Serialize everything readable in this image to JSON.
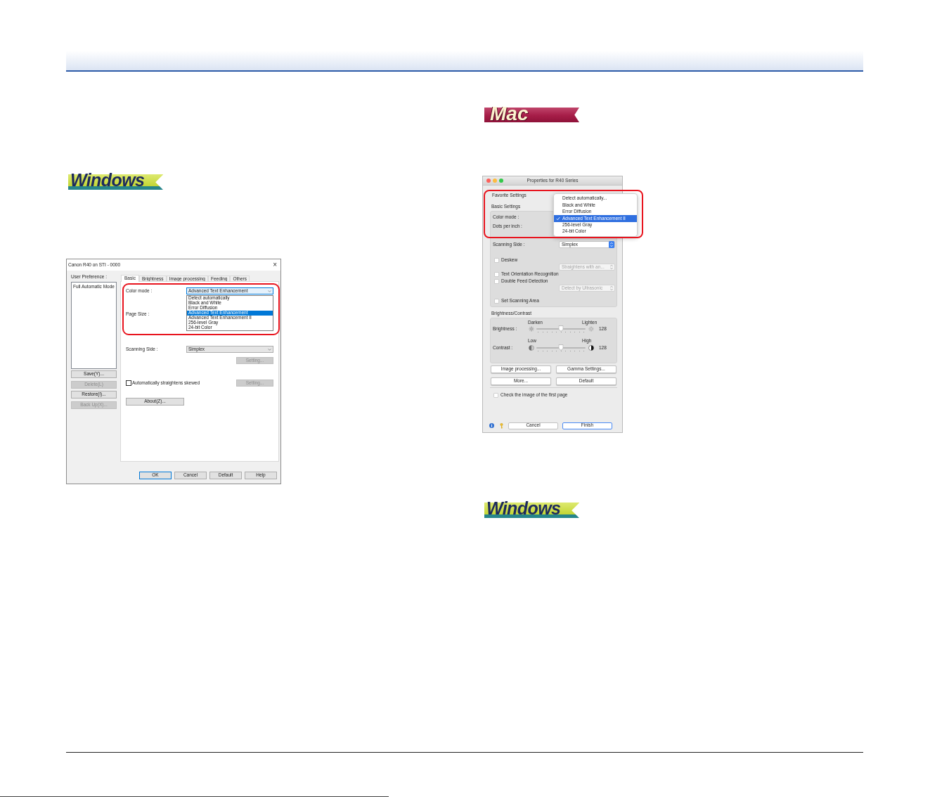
{
  "windows_section": {
    "platform_badge": {
      "kind": "windows",
      "label": "Windows"
    },
    "dialog": {
      "title": "Canon R40 on STI - 0000",
      "close": "×",
      "preference_label": "User Preference :",
      "preference_list": [
        "Full Automatic Mode"
      ],
      "preference_buttons": [
        {
          "label": "Save(Y)...",
          "disabled": false
        },
        {
          "label": "Delete(L)",
          "disabled": true
        },
        {
          "label": "Restore(I)...",
          "disabled": false
        },
        {
          "label": "Back Up(X)...",
          "disabled": true
        }
      ],
      "tabs": [
        {
          "label": "Basic",
          "selected": true
        },
        {
          "label": "Brightness",
          "selected": false
        },
        {
          "label": "Image processing",
          "selected": false
        },
        {
          "label": "Feeding",
          "selected": false
        },
        {
          "label": "Others",
          "selected": false
        }
      ],
      "color_mode": {
        "label": "Color mode :",
        "value": "Advanced Text Enhancement",
        "options": [
          {
            "label": "Detect automatically",
            "selected": false
          },
          {
            "label": "Black and White",
            "selected": false
          },
          {
            "label": "Error Diffusion",
            "selected": false
          },
          {
            "label": "Advanced Text Enhancement",
            "selected": true
          },
          {
            "label": "Advanced Text Enhancement II",
            "selected": false
          },
          {
            "label": "256-level Gray",
            "selected": false
          },
          {
            "label": "24-bit Color",
            "selected": false
          }
        ]
      },
      "page_size": {
        "label": "Page Size :"
      },
      "scanning_side": {
        "label": "Scanning Side :",
        "value": "Simplex"
      },
      "setting_button": {
        "label": "Setting...",
        "disabled": true
      },
      "straighten": {
        "label": "Automatically straightens skewed",
        "checked": false
      },
      "straighten_setting_button": {
        "label": "Setting...",
        "disabled": true
      },
      "about_button": {
        "label": "About(Z)..."
      },
      "footer_buttons": [
        {
          "label": "OK",
          "default": true
        },
        {
          "label": "Cancel",
          "default": false
        },
        {
          "label": "Default",
          "default": false
        },
        {
          "label": "Help",
          "default": false
        }
      ]
    }
  },
  "mac_section": {
    "platform_badge": {
      "kind": "mac",
      "label": "Mac"
    },
    "dialog": {
      "title": "Properties for R40 Series",
      "favorite_settings_label": "Favorite Settings",
      "color_mode_menu": [
        {
          "label": "Detect automatically...",
          "selected": false
        },
        {
          "label": "Black and White",
          "selected": false
        },
        {
          "label": "Error Diffusion",
          "selected": false
        },
        {
          "label": "Advanced Text Enhancement II",
          "selected": true
        },
        {
          "label": "256-level Gray",
          "selected": false
        },
        {
          "label": "24-bit Color",
          "selected": false
        }
      ],
      "basic_settings": {
        "title": "Basic Settings",
        "labels": [
          "Color mode :",
          "Dots per inch :"
        ],
        "scanning_side": {
          "label": "Scanning Side :",
          "value": "Simplex"
        },
        "options": [
          {
            "kind": "checkbox",
            "label": "Deskew",
            "checked": false
          },
          {
            "kind": "popup",
            "value": "Straightens with an...",
            "disabled": true
          },
          {
            "kind": "checkbox",
            "label": "Text Orientation Recognition",
            "checked": false
          },
          {
            "kind": "checkbox",
            "label": "Double Feed Detection",
            "checked": false
          },
          {
            "kind": "popup",
            "value": "Detect by Ultrasonic",
            "disabled": true
          }
        ],
        "scanning_area": {
          "label": "Set Scanning Area",
          "checked": false
        }
      },
      "brightness_contrast": {
        "title": "Brightness/Contrast",
        "sliders": [
          {
            "kind": "brightness",
            "label": "Brightness :",
            "min_label": "Darken",
            "max_label": "Lighten",
            "level": 0.5,
            "reading": "128"
          },
          {
            "kind": "contrast",
            "label": "Contrast :",
            "min_label": "Low",
            "max_label": "High",
            "level": 0.5,
            "reading": "128"
          }
        ]
      },
      "buttons": [
        "Image processing...",
        "Gamma Settings...",
        "More...",
        "Default"
      ],
      "first_page_check": {
        "label": "Check the image of the first page",
        "checked": false
      },
      "footer_buttons": [
        {
          "label": "Cancel",
          "default": false
        },
        {
          "label": "Finish",
          "default": true
        }
      ]
    }
  },
  "windows_section_2": {
    "platform_badge": {
      "kind": "windows",
      "label": "Windows"
    }
  }
}
